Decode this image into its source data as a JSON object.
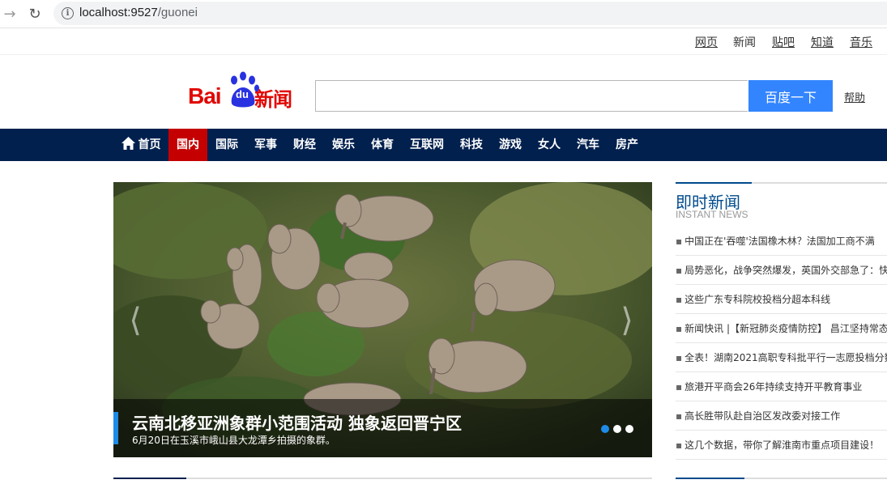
{
  "browser": {
    "url_host": "localhost:9527",
    "url_path": "/guonei"
  },
  "toplinks": [
    {
      "label": "网页",
      "underlined": true
    },
    {
      "label": "新闻",
      "underlined": false
    },
    {
      "label": "贴吧",
      "underlined": true
    },
    {
      "label": "知道",
      "underlined": true
    },
    {
      "label": "音乐",
      "underlined": true
    }
  ],
  "logo": {
    "bai": "Bai",
    "du": "du",
    "xinwen": "新闻",
    "brand_red": "#e10602",
    "paw_blue": "#2932e1"
  },
  "search": {
    "value": "",
    "button_label": "百度一下",
    "help_label": "帮助",
    "button_color": "#3385ff"
  },
  "nav": {
    "background": "#01204e",
    "active_color": "#c40000",
    "items": [
      {
        "label": "首页",
        "icon": "home-icon",
        "active": false
      },
      {
        "label": "国内",
        "active": true
      },
      {
        "label": "国际",
        "active": false
      },
      {
        "label": "军事",
        "active": false
      },
      {
        "label": "财经",
        "active": false
      },
      {
        "label": "娱乐",
        "active": false
      },
      {
        "label": "体育",
        "active": false
      },
      {
        "label": "互联网",
        "active": false
      },
      {
        "label": "科技",
        "active": false
      },
      {
        "label": "游戏",
        "active": false
      },
      {
        "label": "女人",
        "active": false
      },
      {
        "label": "汽车",
        "active": false
      },
      {
        "label": "房产",
        "active": false
      }
    ]
  },
  "slider": {
    "headline": "云南北移亚洲象群小范围活动 独象返回晋宁区",
    "subline": "6月20日在玉溪市峨山县大龙潭乡拍摄的象群。",
    "prev_icon": "chevron-left-icon",
    "next_icon": "chevron-right-icon",
    "slide_count": 3,
    "active_slide": 1
  },
  "instant_news": {
    "title": "即时新闻",
    "subtitle": "INSTANT NEWS",
    "items": [
      "中国正在'吞噬'法国橡木林？法国加工商不满",
      "局势恶化，战争突然爆发，英国外交部急了：快",
      "这些广东专科院校投档分超本科线",
      "新闻快讯 |【新冠肺炎疫情防控】 昌江坚持常态",
      "全表！湖南2021高职专科批平行一志愿投档分数",
      "旅港开平商会26年持续支持开平教育事业",
      "高长胜带队赴自治区发改委对接工作",
      "这几个数据，带你了解淮南市重点项目建设！"
    ]
  }
}
